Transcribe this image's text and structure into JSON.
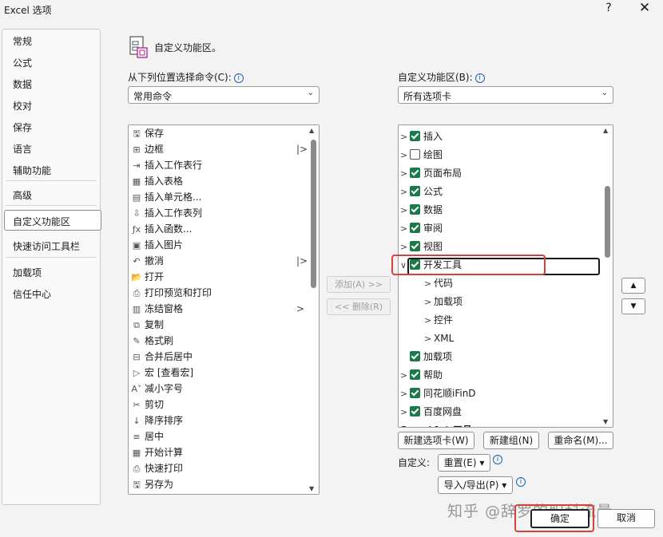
{
  "window": {
    "title": "Excel 选项",
    "help": "?",
    "close": "✕"
  },
  "categories": [
    {
      "label": "常规"
    },
    {
      "label": "公式"
    },
    {
      "label": "数据"
    },
    {
      "label": "校对"
    },
    {
      "label": "保存"
    },
    {
      "label": "语言"
    },
    {
      "label": "辅助功能"
    },
    {
      "label": "高级"
    },
    {
      "label": "自定义功能区"
    },
    {
      "label": "快速访问工具栏"
    },
    {
      "label": "加载项"
    },
    {
      "label": "信任中心"
    }
  ],
  "heading": "自定义功能区。",
  "left": {
    "label": "从下列位置选择命令(C):",
    "dropdown_value": "常用命令",
    "commands": [
      {
        "label": "保存",
        "icon": "save-icon"
      },
      {
        "label": "边框",
        "icon": "border-icon",
        "more": "|>"
      },
      {
        "label": "插入工作表行",
        "icon": "insert-row-icon"
      },
      {
        "label": "插入表格",
        "icon": "table-icon"
      },
      {
        "label": "插入单元格...",
        "icon": "insert-cells-icon"
      },
      {
        "label": "插入工作表列",
        "icon": "insert-column-icon"
      },
      {
        "label": "插入函数...",
        "icon": "function-icon"
      },
      {
        "label": "插入图片",
        "icon": "picture-icon"
      },
      {
        "label": "撤消",
        "icon": "undo-icon",
        "more": "|>"
      },
      {
        "label": "打开",
        "icon": "open-folder-icon"
      },
      {
        "label": "打印预览和打印",
        "icon": "print-preview-icon"
      },
      {
        "label": "冻结窗格",
        "icon": "freeze-panes-icon",
        "more": ">"
      },
      {
        "label": "复制",
        "icon": "copy-icon"
      },
      {
        "label": "格式刷",
        "icon": "format-painter-icon"
      },
      {
        "label": "合并后居中",
        "icon": "merge-center-icon"
      },
      {
        "label": "宏 [查看宏]",
        "icon": "macro-icon"
      },
      {
        "label": "减小字号",
        "icon": "decrease-font-icon"
      },
      {
        "label": "剪切",
        "icon": "cut-icon"
      },
      {
        "label": "降序排序",
        "icon": "sort-desc-icon"
      },
      {
        "label": "居中",
        "icon": "align-center-icon"
      },
      {
        "label": "开始计算",
        "icon": "calculate-icon"
      },
      {
        "label": "快速打印",
        "icon": "quick-print-icon"
      },
      {
        "label": "另存为",
        "icon": "save-as-icon"
      }
    ]
  },
  "middle": {
    "add_label": "添加(A) >>",
    "remove_label": "<< 删除(R)"
  },
  "right": {
    "label": "自定义功能区(B):",
    "dropdown_value": "所有选项卡",
    "tabs": [
      {
        "label": "插入",
        "checked": true,
        "expander": ">",
        "level": 0
      },
      {
        "label": "绘图",
        "checked": false,
        "expander": ">",
        "level": 0
      },
      {
        "label": "页面布局",
        "checked": true,
        "expander": ">",
        "level": 0
      },
      {
        "label": "公式",
        "checked": true,
        "expander": ">",
        "level": 0
      },
      {
        "label": "数据",
        "checked": true,
        "expander": ">",
        "level": 0
      },
      {
        "label": "审阅",
        "checked": true,
        "expander": ">",
        "level": 0
      },
      {
        "label": "视图",
        "checked": true,
        "expander": ">",
        "level": 0
      },
      {
        "label": "开发工具",
        "checked": true,
        "expander": "∨",
        "level": 0
      },
      {
        "label": "代码",
        "expander": ">",
        "level": 1
      },
      {
        "label": "加载项",
        "expander": ">",
        "level": 1
      },
      {
        "label": "控件",
        "expander": ">",
        "level": 1
      },
      {
        "label": "XML",
        "expander": ">",
        "level": 1
      },
      {
        "label": "加载项",
        "checked": true,
        "expander": "",
        "level": 0
      },
      {
        "label": "帮助",
        "checked": true,
        "expander": ">",
        "level": 0
      },
      {
        "label": "同花顺iFinD",
        "checked": true,
        "expander": ">",
        "level": 0
      },
      {
        "label": "百度网盘",
        "checked": true,
        "expander": ">",
        "level": 0
      }
    ],
    "section_header": "SmartArt 工具",
    "new_tab_label": "新建选项卡(W)",
    "new_group_label": "新建组(N)",
    "rename_label": "重命名(M)...",
    "customize_label": "自定义:",
    "reset_label": "重置(E) ▾",
    "import_export_label": "导入/导出(P) ▾"
  },
  "footer": {
    "ok_label": "确定",
    "cancel_label": "取消"
  },
  "watermark": "知乎 @辞罗的职科流量",
  "colors": {
    "accent": "#1c7a4a",
    "highlight": "#d9403a"
  }
}
